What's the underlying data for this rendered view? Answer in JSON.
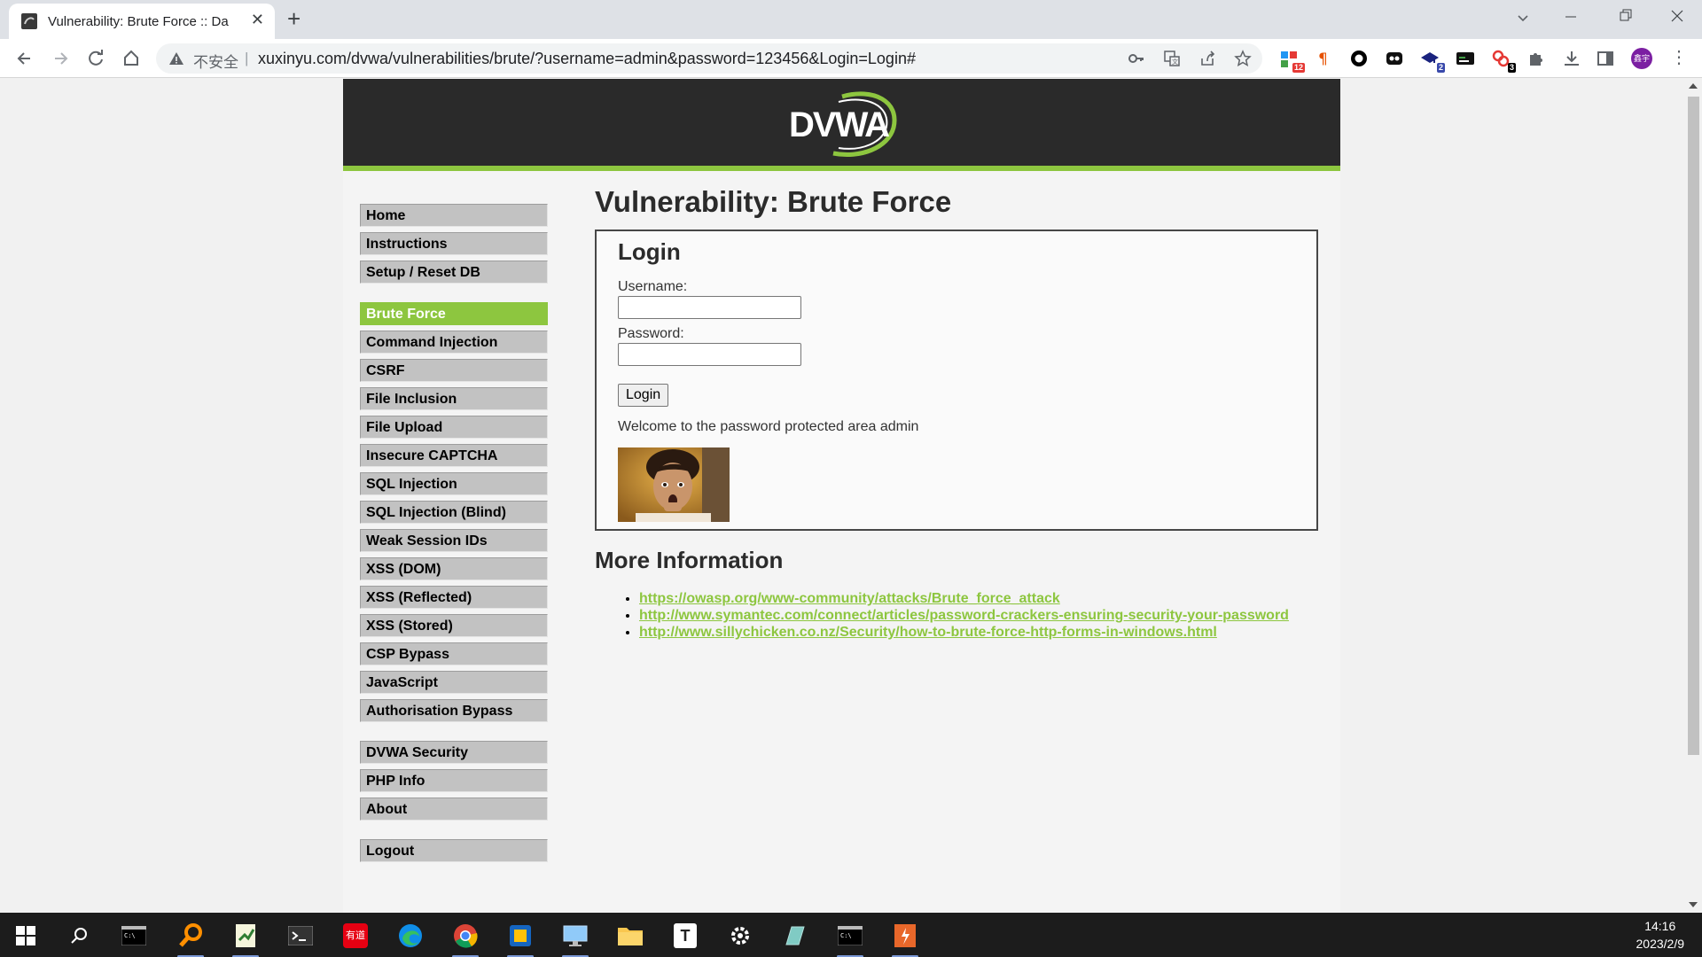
{
  "browser": {
    "tab_title": "Vulnerability: Brute Force :: Da",
    "omnibox_security": "不安全",
    "omnibox_separator": "|",
    "url": "xuxinyu.com/dvwa/vulnerabilities/brute/?username=admin&password=123456&Login=Login#",
    "new_tab": "+",
    "close_tab": "✕",
    "extensions": [
      {
        "name": "extension-1",
        "badge": "12"
      },
      {
        "name": "extension-2",
        "badge": ""
      },
      {
        "name": "extension-3",
        "badge": ""
      },
      {
        "name": "extension-4",
        "badge": ""
      },
      {
        "name": "extension-5",
        "badge": "2"
      },
      {
        "name": "extension-6",
        "badge": ""
      },
      {
        "name": "extension-7",
        "badge": "3"
      }
    ],
    "avatar_text": "鑫宇"
  },
  "header": {
    "logo_text": "DVWA"
  },
  "menu": {
    "groups": [
      [
        "Home",
        "Instructions",
        "Setup / Reset DB"
      ],
      [
        "Brute Force",
        "Command Injection",
        "CSRF",
        "File Inclusion",
        "File Upload",
        "Insecure CAPTCHA",
        "SQL Injection",
        "SQL Injection (Blind)",
        "Weak Session IDs",
        "XSS (DOM)",
        "XSS (Reflected)",
        "XSS (Stored)",
        "CSP Bypass",
        "JavaScript",
        "Authorisation Bypass"
      ],
      [
        "DVWA Security",
        "PHP Info",
        "About"
      ],
      [
        "Logout"
      ]
    ],
    "selected": "Brute Force"
  },
  "main": {
    "title": "Vulnerability: Brute Force",
    "login_heading": "Login",
    "username_label": "Username:",
    "password_label": "Password:",
    "username_value": "",
    "password_value": "",
    "login_button": "Login",
    "welcome": "Welcome to the password protected area admin",
    "more_info_heading": "More Information",
    "links": [
      "https://owasp.org/www-community/attacks/Brute_force_attack",
      "http://www.symantec.com/connect/articles/password-crackers-ensuring-security-your-password",
      "http://www.sillychicken.co.nz/Security/how-to-brute-force-http-forms-in-windows.html"
    ]
  },
  "taskbar": {
    "time": "14:16",
    "date": "2023/2/9",
    "youdao_label": "有道",
    "typora_label": "T"
  },
  "colors": {
    "accent_green": "#8dc63f",
    "header_bg": "#2a2a2a",
    "menu_gray": "#c2c2c2"
  }
}
